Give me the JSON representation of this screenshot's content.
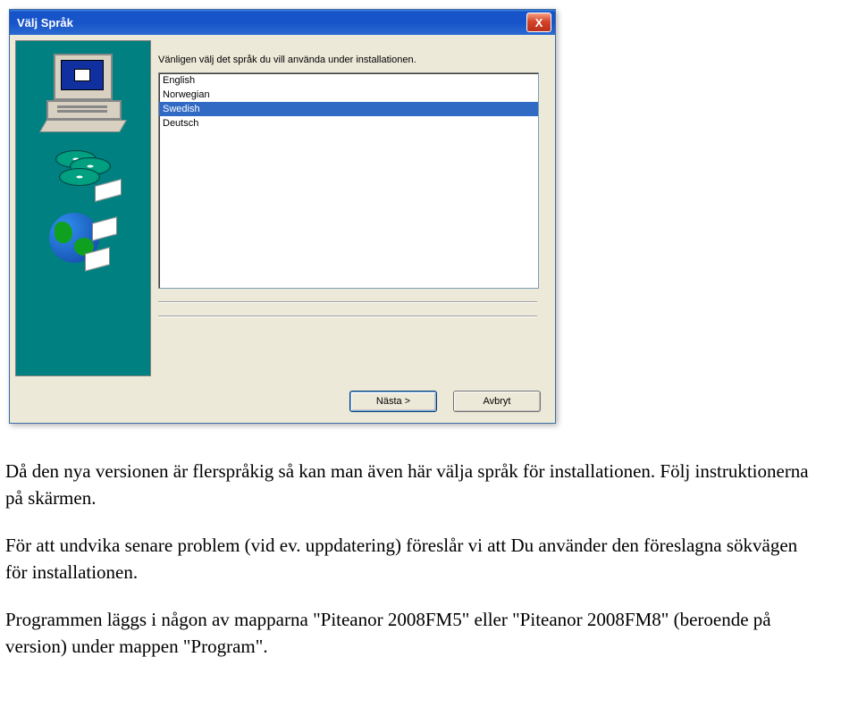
{
  "dialog": {
    "title": "Välj Språk",
    "close_symbol": "X",
    "instruction": "Vänligen välj det språk du vill använda under installationen.",
    "languages": [
      {
        "label": "English",
        "selected": false
      },
      {
        "label": "Norwegian",
        "selected": false
      },
      {
        "label": "Swedish",
        "selected": true
      },
      {
        "label": "Deutsch",
        "selected": false
      }
    ],
    "buttons": {
      "next": "Nästa >",
      "cancel": "Avbryt"
    }
  },
  "document": {
    "p1": "Då den nya versionen är flerspråkig så kan man även här välja språk för installationen. Följ instruktionerna på skärmen.",
    "p2": "För att undvika senare problem (vid ev. uppdatering) föreslår vi att Du använder den föreslagna sökvägen för installationen.",
    "p3": "Programmen läggs i någon av mapparna \"Piteanor 2008FM5\" eller \"Piteanor 2008FM8\" (beroende på version) under mappen \"Program\"."
  }
}
